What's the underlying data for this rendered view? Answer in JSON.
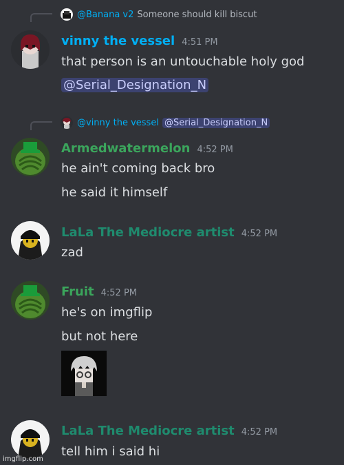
{
  "colors": {
    "background": "#313338",
    "name_blue": "#00aff4",
    "name_green": "#3ba55c",
    "name_teal": "#1f8b6e",
    "mention_bg": "#3c4270",
    "mention_text": "#c9cdfb"
  },
  "messages": [
    {
      "reply": {
        "author": "@Banana v2",
        "text": "Someone should kill biscut"
      },
      "author": "vinny the vessel",
      "time": "4:51 PM",
      "lines": [
        "that person is an untouchable holy god"
      ],
      "mention": "@Serial_Designation_N"
    },
    {
      "reply": {
        "author": "@vinny the vessel",
        "mention": "@Serial_Designation_N"
      },
      "author": "Armedwatermelon",
      "time": "4:52 PM",
      "lines": [
        "he ain't coming back bro",
        "he said it himself"
      ]
    },
    {
      "author": "LaLa The Mediocre artist",
      "time": "4:52 PM",
      "lines": [
        "zad"
      ]
    },
    {
      "author": "Fruit",
      "time": "4:52 PM",
      "lines": [
        "he's on imgflip",
        "but not here"
      ]
    },
    {
      "author": "LaLa The Mediocre artist",
      "time": "4:52 PM",
      "lines": [
        "tell him i said hi"
      ]
    }
  ],
  "watermark": "imgflip.com"
}
